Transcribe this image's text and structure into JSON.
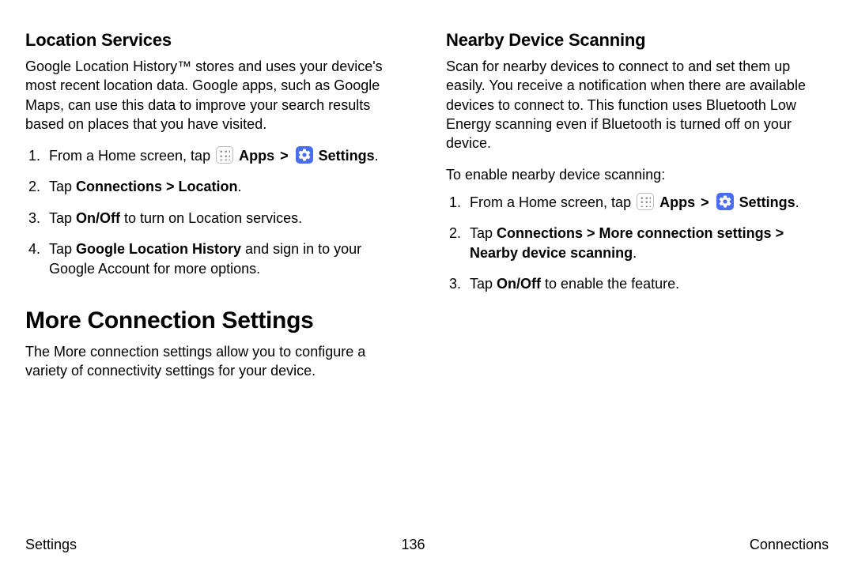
{
  "left": {
    "location_services": {
      "title": "Location Services",
      "body": "Google Location History™ stores and uses your device's most recent location data. Google apps, such as Google Maps, can use this data to improve your search results based on places that you have visited.",
      "steps": {
        "s1_pre": "From a Home screen, tap ",
        "s1_apps": "Apps",
        "s1_chev": " > ",
        "s1_settings": "Settings",
        "s1_post": ".",
        "s2_pre": "Tap ",
        "s2_bold": "Connections > Location",
        "s2_post": ".",
        "s3_pre": "Tap ",
        "s3_bold": "On/Off",
        "s3_post": " to turn on Location services.",
        "s4_pre": "Tap ",
        "s4_bold": "Google Location History",
        "s4_post": " and sign in to your Google Account for more options."
      }
    },
    "more_connection": {
      "title": "More Connection Settings",
      "body": "The More connection settings allow you to configure a variety of connectivity settings for your device."
    }
  },
  "right": {
    "nearby": {
      "title": "Nearby Device Scanning",
      "body": "Scan for nearby devices to connect to and set them up easily. You receive a notification when there are available devices to connect to. This function uses Bluetooth Low Energy scanning even if Bluetooth is turned off on your device.",
      "lead": "To enable nearby device scanning:",
      "steps": {
        "s1_pre": "From a Home screen, tap ",
        "s1_apps": "Apps",
        "s1_chev": " > ",
        "s1_settings": "Settings",
        "s1_post": ".",
        "s2_pre": "Tap ",
        "s2_bold": "Connections > More connection settings > Nearby device scanning",
        "s2_post": ".",
        "s3_pre": "Tap ",
        "s3_bold": "On/Off",
        "s3_post": " to enable the feature."
      }
    }
  },
  "footer": {
    "left": "Settings",
    "center": "136",
    "right": "Connections"
  },
  "icons": {
    "apps": "apps-icon",
    "settings": "settings-icon"
  }
}
